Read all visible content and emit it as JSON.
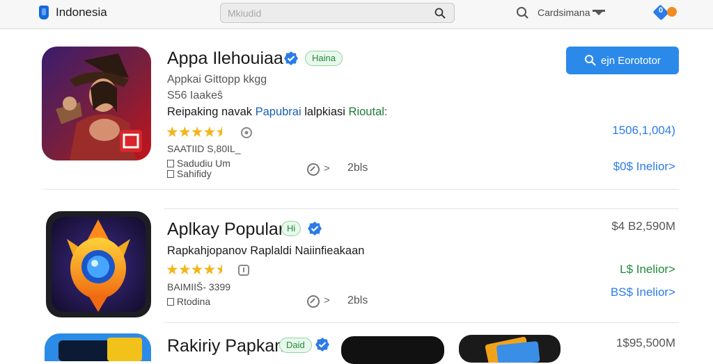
{
  "topbar": {
    "brand_label": "Indonesia",
    "search": {
      "value": "",
      "placeholder": "Mkiudid"
    },
    "region_label": "Cardsimana",
    "notification_count": "0"
  },
  "apps": [
    {
      "title": "Appa Ilehouiaa",
      "badge": "Haina",
      "subtitle": "Appkai Gittopp kkgg",
      "sub2": "S56 Iaakeŝ",
      "desc_prefix": "Reipaking navak",
      "desc_blue": "Papubrai",
      "desc_mid": "lalpkiasi",
      "desc_green": "Rioutal:",
      "meta1": "SAATIID  S,80IL_",
      "meta2": "Sadudiu Um",
      "meta3": "Sahifidy",
      "comments": "2bls",
      "install_label": "ejn Eorototor",
      "right_top": "1506,1,004)",
      "right_link": "$0$ Inelior>",
      "rating": 4.5
    },
    {
      "title": "Aplkay Popular",
      "badge": "Hi",
      "desc": "Rapkahjopanov Raplaldi Naiinfieakaan",
      "meta1": "BAIMIIŠ- 3399",
      "meta2": "Rtodina",
      "comments": "2bls",
      "price": "$4 B2,590M",
      "link_green": "L$ Inelior>",
      "link_blue": "BS$ Inelior>",
      "rating": 4.5
    },
    {
      "title": "Rakiriy Papkan",
      "badge": "Daid",
      "price": "1$95,500M"
    }
  ],
  "colors": {
    "accent": "#2b8ae9",
    "star": "#f2b51a",
    "verified": "#2b7be8",
    "badge_green": "#1f8a3a"
  }
}
